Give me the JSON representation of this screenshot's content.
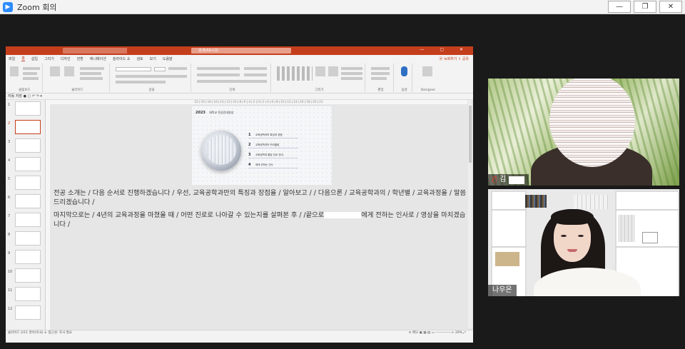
{
  "window": {
    "title": "Zoom 회의",
    "minimize": "—",
    "restore": "❐",
    "close": "✕"
  },
  "ppt": {
    "search_placeholder": "검색(Alt+Q)",
    "tabs": [
      "파일",
      "홈",
      "삽입",
      "그리기",
      "디자인",
      "전환",
      "애니메이션",
      "슬라이드 쇼",
      "검토",
      "보기",
      "도움말"
    ],
    "active_tab": "홈",
    "record_label": "⦿ 녹화하기",
    "share_label": "⇪ 공유",
    "groups": [
      "클립보드",
      "슬라이드",
      "글꼴",
      "단락",
      "그리기",
      "편집",
      "음성",
      "Designer"
    ],
    "qat": "자동 저장 ● ▢ ↶ ↷ ▾",
    "ruler": "·22·|·20·|·18·|·16·|·14·|·12·|·10·|·8·|·6·|·4·|·2·|·0·|·2·|·4·|·6·|·8·|·10·|·12·|·14·|·16·|·18·|·20·|·22·",
    "slide_numbers": [
      "1",
      "2",
      "3",
      "4",
      "5",
      "6",
      "7",
      "8",
      "9",
      "10",
      "11",
      "12"
    ],
    "slide": {
      "year": "2023",
      "small_title": "대학교 전공안내영상",
      "menu": [
        {
          "num": "1",
          "label": "교육공학과의 특징과 장점"
        },
        {
          "num": "2",
          "label": "교육공학과의 커리큘럼"
        },
        {
          "num": "3",
          "label": "교육공학과 졸업 진로 안내"
        },
        {
          "num": "4",
          "label": "에게 전하는 인사"
        }
      ]
    },
    "notes": {
      "para1": "전공 소개는 / 다음 순서로 진행하겠습니다 / 우선, 교육공학과만의 특징과 장점을 / 알아보고 / / 다음으론 / 교육공학과의 / 학년별 / 교육과정을 / 말씀드리겠습니다 /",
      "para2_a": "마지막으로는 / 4년의 교육과정을 마쳤을 때 / 어떤 진로로 나아갈 수 있는지를 살펴본 후 / /끝으로",
      "para2_b": "에게 전하는 인사로 / 영상을 마치겠습니다 /"
    },
    "status_left": "슬라이드 2/11   영어(미국)   ♿ 접근성: 조사 필요",
    "status_right": "≡ 메모   ▣ ▦ ▤ ▭  —————+  29%  ⤢"
  },
  "participants": [
    {
      "name": "김",
      "muted": true
    },
    {
      "name": "나우온",
      "muted": false
    }
  ]
}
